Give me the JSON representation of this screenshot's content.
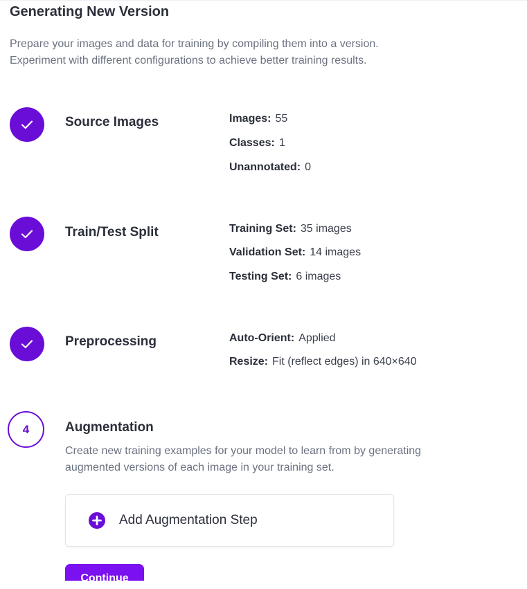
{
  "page": {
    "title": "Generating New Version",
    "description_lines": [
      "Prepare your images and data for training by compiling them into a version.",
      "Experiment with different configurations to achieve better training results."
    ]
  },
  "colors": {
    "accent": "#6a0dd6",
    "button": "#7b10f0"
  },
  "steps": [
    {
      "status": "complete",
      "icon": "check-icon",
      "title": "Source Images",
      "details": [
        {
          "key": "Images:",
          "value": "55"
        },
        {
          "key": "Classes:",
          "value": "1"
        },
        {
          "key": "Unannotated:",
          "value": "0"
        }
      ]
    },
    {
      "status": "complete",
      "icon": "check-icon",
      "title": "Train/Test Split",
      "details": [
        {
          "key": "Training Set:",
          "value": "35 images"
        },
        {
          "key": "Validation Set:",
          "value": "14 images"
        },
        {
          "key": "Testing Set:",
          "value": "6 images"
        }
      ]
    },
    {
      "status": "complete",
      "icon": "check-icon",
      "title": "Preprocessing",
      "details": [
        {
          "key": "Auto-Orient:",
          "value": "Applied"
        },
        {
          "key": "Resize:",
          "value": "Fit (reflect edges) in 640×640"
        }
      ]
    },
    {
      "status": "current",
      "number": "4",
      "title": "Augmentation",
      "description_lines": [
        "Create new training examples for your model to learn from by generating",
        "augmented versions of each image in your training set."
      ],
      "add_button_label": "Add Augmentation Step",
      "add_button_icon": "plus-circle-icon",
      "continue_label": "Continue"
    }
  ]
}
